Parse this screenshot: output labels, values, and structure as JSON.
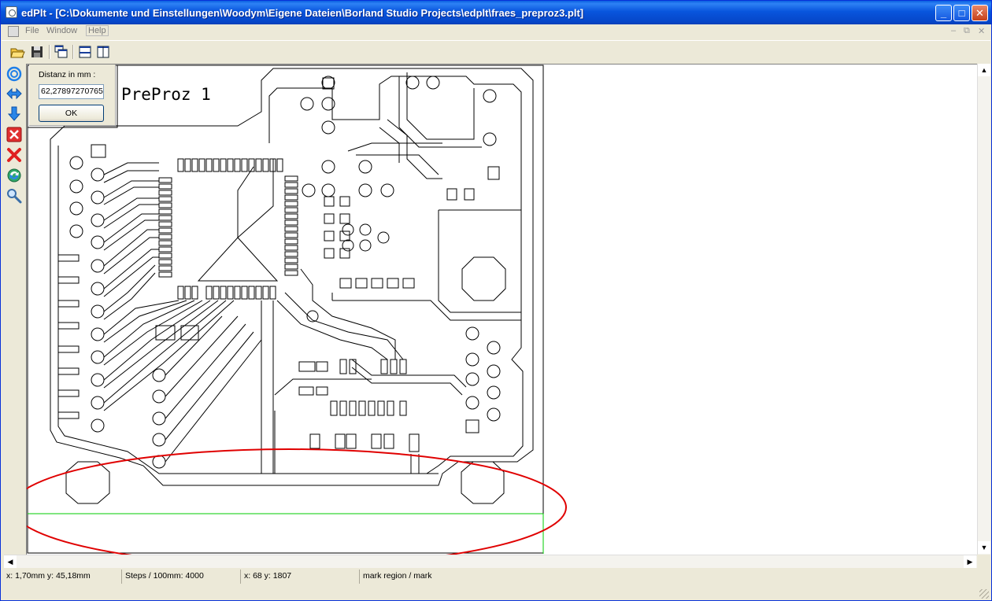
{
  "window": {
    "title": "edPlt - [C:\\Dokumente und Einstellungen\\Woodym\\Eigene Dateien\\Borland Studio Projects\\edplt\\fraes_preproz3.plt]",
    "controls": {
      "minimize": "_",
      "maximize": "□",
      "close": "✕"
    }
  },
  "menu": {
    "items": [
      "File",
      "Window",
      "Help"
    ],
    "mdi_controls": [
      "–",
      "⧉",
      "✕"
    ]
  },
  "toolbar": {
    "icons": [
      "open-folder-icon",
      "save-disk-icon",
      "cascade-windows-icon",
      "tile-horizontal-icon",
      "tile-vertical-icon"
    ]
  },
  "left_tools": {
    "icons": [
      "target-circle-icon",
      "move-horizontal-icon",
      "move-down-icon",
      "delete-box-icon",
      "delete-cross-icon",
      "refresh-icon",
      "magnifier-icon"
    ]
  },
  "dialog": {
    "label": "Distanz in mm :",
    "input_value": "62,27897270765",
    "ok_label": "OK"
  },
  "drawing": {
    "label": "PreProz 1",
    "colors": {
      "lines": "#000000",
      "mark_line": "#00cc00",
      "highlight_ellipse": "#e00000"
    }
  },
  "status": {
    "position": "x: 1,70mm y: 45,18mm",
    "steps": "Steps / 100mm: 4000",
    "pixel": "x: 68 y: 1807",
    "mode": "mark region / mark"
  }
}
